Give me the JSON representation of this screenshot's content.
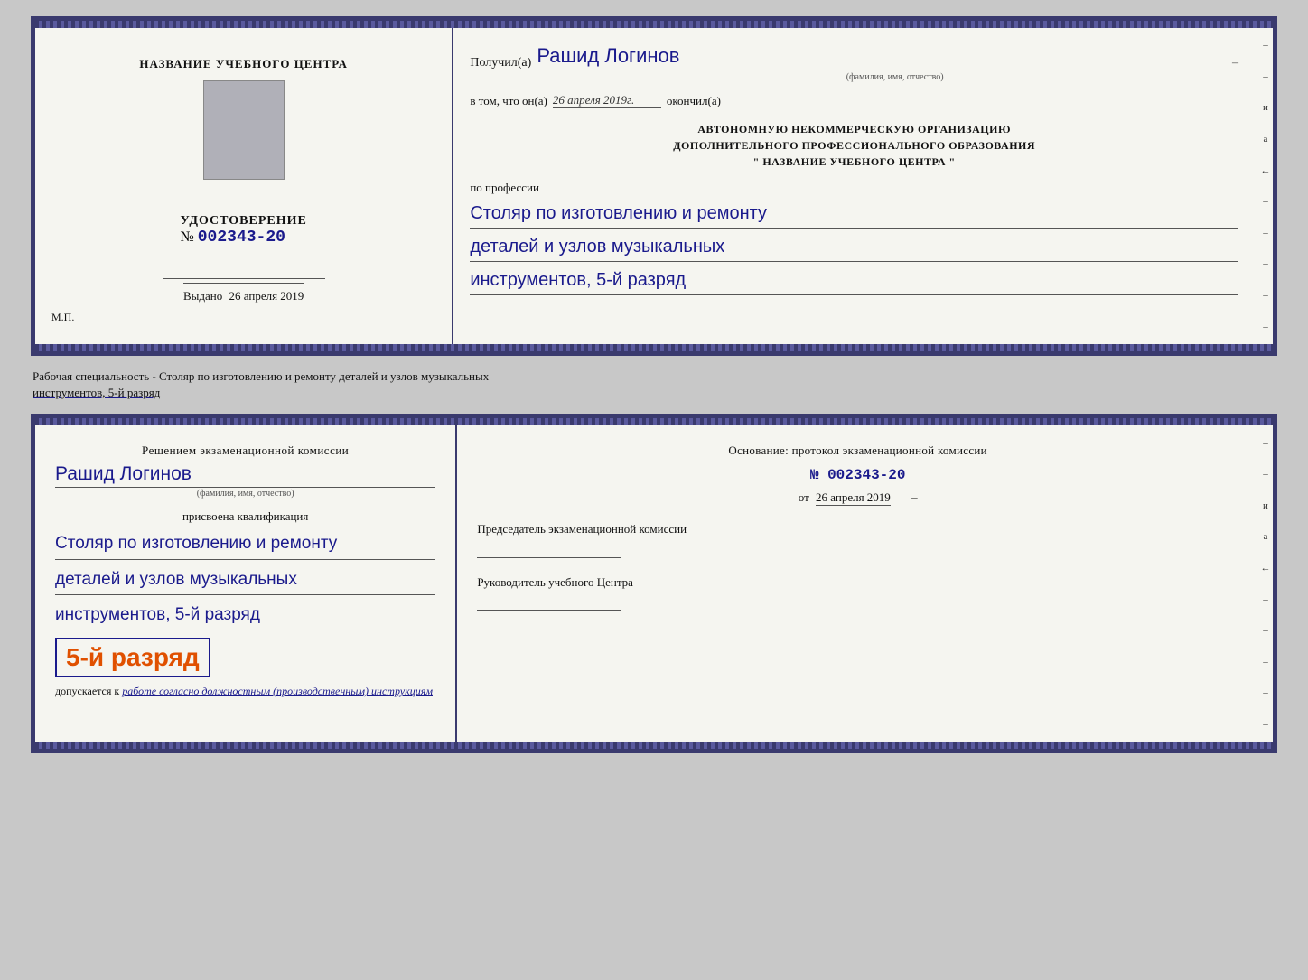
{
  "top_doc": {
    "left": {
      "center_title": "НАЗВАНИЕ УЧЕБНОГО ЦЕНТРА",
      "photo_alt": "photo",
      "udost_label": "УДОСТОВЕРЕНИЕ",
      "udost_no_prefix": "№",
      "udost_number": "002343-20",
      "vydano_prefix": "Выдано",
      "vydano_date": "26 апреля 2019",
      "mp_label": "М.П."
    },
    "right": {
      "poluchil_label": "Получил(а)",
      "handwritten_name": "Рашид Логинов",
      "dash": "–",
      "fio_sub": "(фамилия, имя, отчество)",
      "vtom_label": "в том, что он(а)",
      "vtom_date": "26 апреля 2019г.",
      "okoncil_label": "окончил(а)",
      "org_line1": "АВТОНОМНУЮ НЕКОММЕРЧЕСКУЮ ОРГАНИЗАЦИЮ",
      "org_line2": "ДОПОЛНИТЕЛЬНОГО ПРОФЕССИОНАЛЬНОГО ОБРАЗОВАНИЯ",
      "org_line3": "\"  НАЗВАНИЕ УЧЕБНОГО ЦЕНТРА  \"",
      "po_professii": "по профессии",
      "qual_line1": "Столяр по изготовлению и ремонту",
      "qual_line2": "деталей и узлов музыкальных",
      "qual_line3": "инструментов, 5-й разряд"
    }
  },
  "between": {
    "text": "Рабочая специальность - Столяр по изготовлению и ремонту деталей и узлов музыкальных инструментов, 5-й разряд"
  },
  "bottom_doc": {
    "left": {
      "reshen_label": "Решением экзаменационной комиссии",
      "handwritten_name": "Рашид Логинов",
      "fio_sub": "(фамилия, имя, отчество)",
      "prisvoyena": "присвоена квалификация",
      "qual_line1": "Столяр по изготовлению и ремонту",
      "qual_line2": "деталей и узлов музыкальных",
      "qual_line3": "инструментов, 5-й разряд",
      "razryad_text": "5-й разряд",
      "dopusk_prefix": "допускается к",
      "dopusk_italic": "работе согласно должностным (производственным) инструкциям"
    },
    "right": {
      "osnov_label": "Основание: протокол экзаменационной комиссии",
      "number_prefix": "№",
      "number": "002343-20",
      "ot_prefix": "от",
      "ot_date": "26 апреля 2019",
      "predsed_label": "Председатель экзаменационной комиссии",
      "rukov_label": "Руководитель учебного Центра"
    }
  },
  "side_chars": [
    "–",
    "–",
    "и",
    "а",
    "←",
    "–",
    "–",
    "–",
    "–",
    "–"
  ]
}
